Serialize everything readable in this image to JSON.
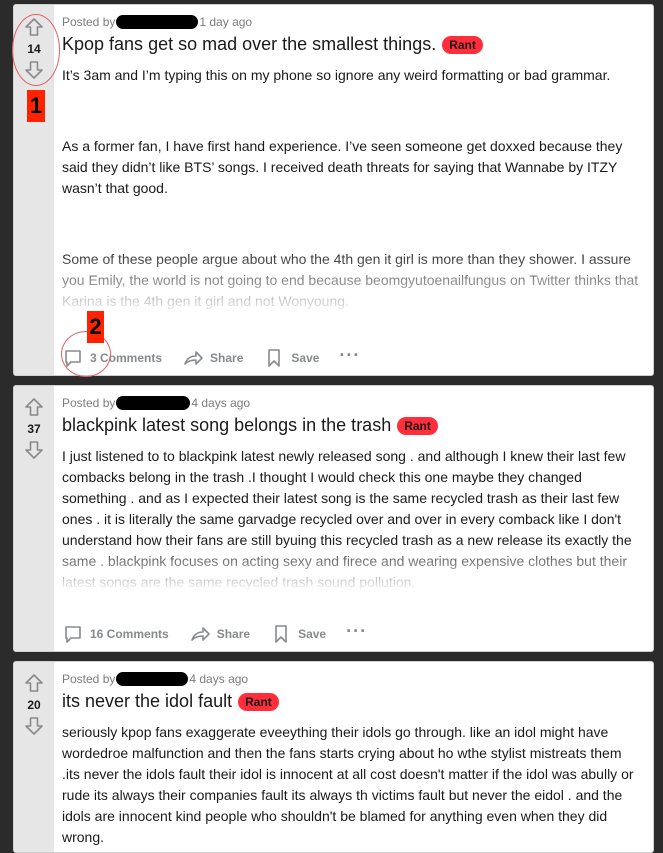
{
  "posts": [
    {
      "votes": "14",
      "posted_by": "Posted by",
      "time": "1 day ago",
      "title": "Kpop fans get so mad over the smallest things.",
      "flair": "Rant",
      "paragraphs": [
        "It’s 3am and I’m typing this on my phone so ignore any weird formatting or bad grammar.",
        "As a former fan, I have first hand experience. I’ve seen someone get doxxed because they said they didn’t like BTS’ songs. I received death threats for saying that Wannabe by ITZY wasn’t that good.",
        "Some of these people argue about who the 4th gen it girl is more than they shower. I assure you Emily, the world is not going to end because beomgyutoenailfungus on Twitter thinks that Karina is the 4th gen it girl and not Wonyoung."
      ],
      "comments": "3 Comments",
      "share": "Share",
      "save": "Save",
      "more": "···"
    },
    {
      "votes": "37",
      "posted_by": "Posted by",
      "time": "4 days ago",
      "title": "blackpink latest song belongs in the trash",
      "flair": "Rant",
      "paragraphs": [
        "I just listened to to blackpink latest newly released song . and although I knew their last few combacks belong in the trash .I thought I would check this one maybe they changed something . and as I expected their latest song is the same recycled trash as their last few ones . it is literally the same garvadge recycled over and over in every comback like I don't understand how their fans are still byuing this recycled trash as a new release its exactly the same . blackpink focuses on acting sexy and firece and wearing expensive clothes but their latest songs are the same recycled trash sound pollution."
      ],
      "comments": "16 Comments",
      "share": "Share",
      "save": "Save",
      "more": "···"
    },
    {
      "votes": "20",
      "posted_by": "Posted by",
      "time": "4 days ago",
      "title": "its never the idol fault",
      "flair": "Rant",
      "paragraphs": [
        "seriously kpop fans exaggerate eveeything their idols go through. like an idol might have wordedroe malfunction and then the fans starts crying about ho wthe stylist mistreats them .its never the idols fault their idol is innocent at all cost doesn't matter if the idol was abully or rude its always their companies fault its always th victims fault but never the eidol . and the idols are innocent kind people who shouldn't be blamed for anything even when they did wrong."
      ]
    }
  ],
  "annotations": {
    "marker1": "1",
    "marker2": "2"
  },
  "colors": {
    "flair": "#ff2e3a",
    "marker": "#ff2200",
    "vote_bg": "#e6e6e6",
    "page_bg": "#2b2b2b"
  }
}
